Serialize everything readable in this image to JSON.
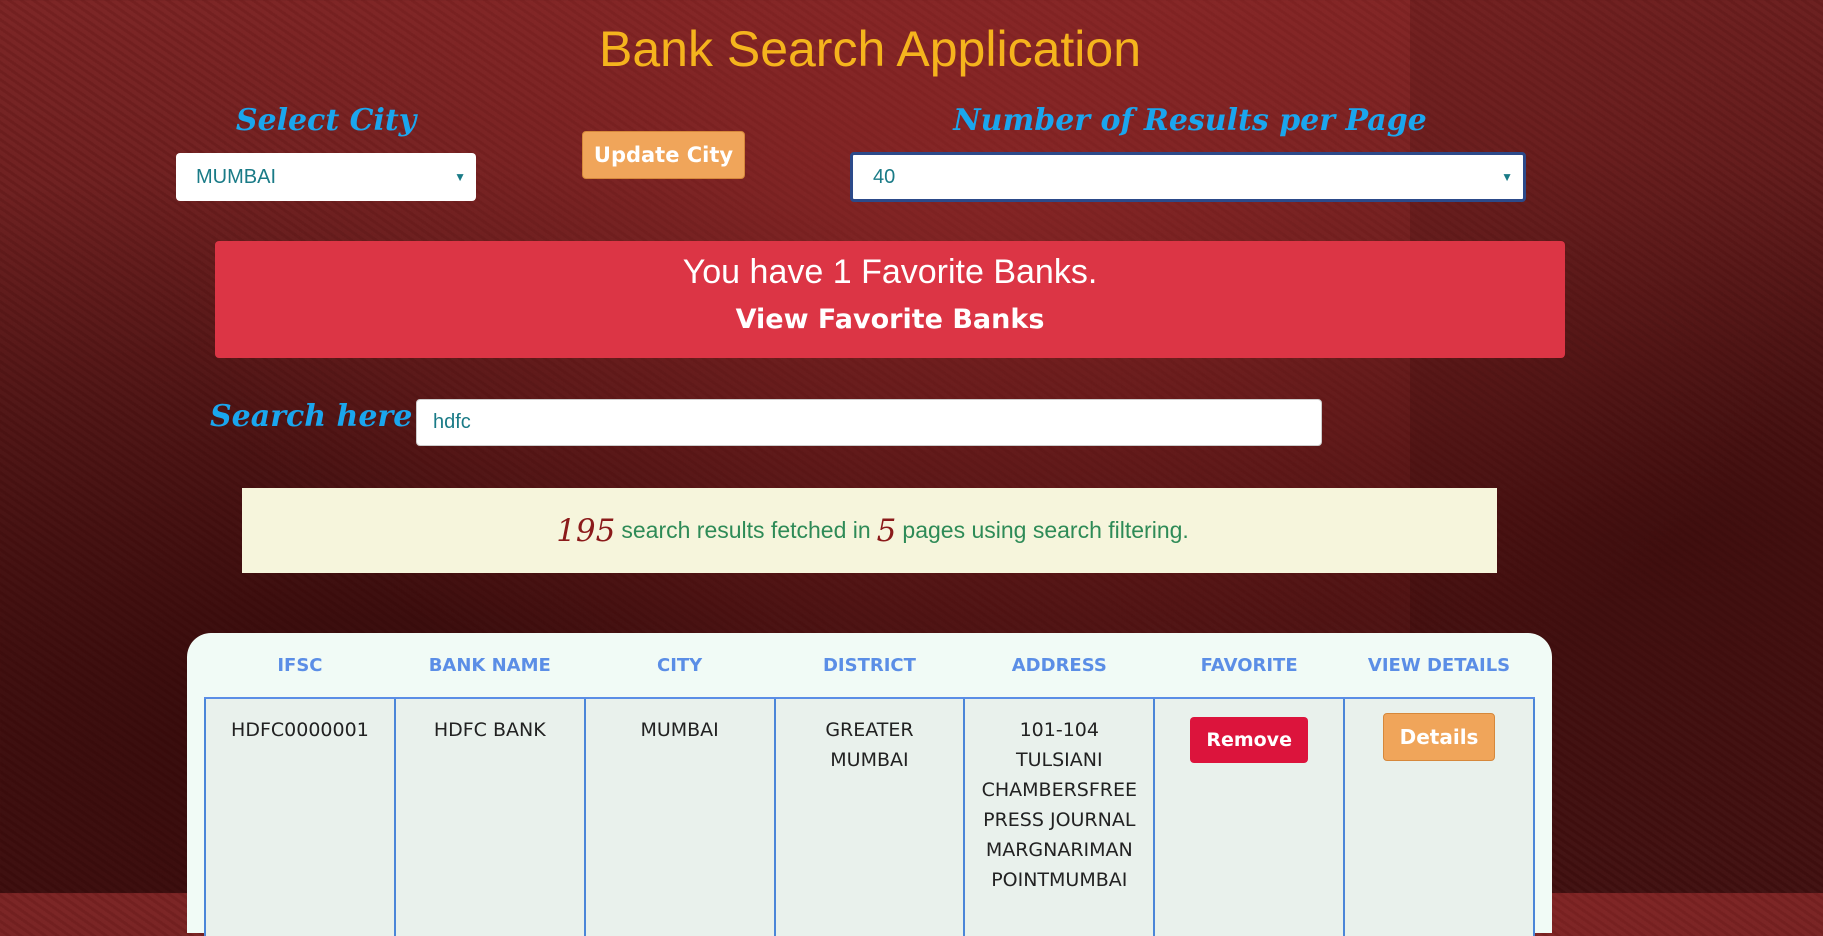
{
  "app": {
    "title": "Bank Search Application"
  },
  "city": {
    "label": "Select City",
    "selected": "MUMBAI"
  },
  "update_button": "Update City",
  "results_per_page": {
    "label": "Number of Results per Page",
    "selected": "40"
  },
  "favorites": {
    "message": "You have 1 Favorite Banks.",
    "link": "View Favorite Banks"
  },
  "search": {
    "label": "Search here",
    "value": "hdfc"
  },
  "summary": {
    "count": "195",
    "text1": "search results fetched in",
    "pages": "5",
    "text2": "pages using search filtering."
  },
  "table": {
    "headers": [
      "IFSC",
      "BANK NAME",
      "CITY",
      "DISTRICT",
      "ADDRESS",
      "FAVORITE",
      "VIEW DETAILS"
    ],
    "rows": [
      {
        "ifsc": "HDFC0000001",
        "bank_name": "HDFC BANK",
        "city": "MUMBAI",
        "district_lines": [
          "GREATER",
          "MUMBAI"
        ],
        "address_lines": [
          "101-104",
          "TULSIANI",
          "CHAMBERSFREE",
          "PRESS JOURNAL",
          "MARGNARIMAN",
          "POINTMUMBAI"
        ],
        "favorite_button": "Remove",
        "details_button": "Details"
      }
    ]
  },
  "colors": {
    "title": "#f5b41d",
    "label": "#1aa6ee",
    "favorite_bar": "#dc3545",
    "remove": "#dc143c",
    "details": "#f0a55a",
    "header_text": "#5b8ee6"
  },
  "icons": {
    "select_arrow": "chevron-down-icon"
  }
}
